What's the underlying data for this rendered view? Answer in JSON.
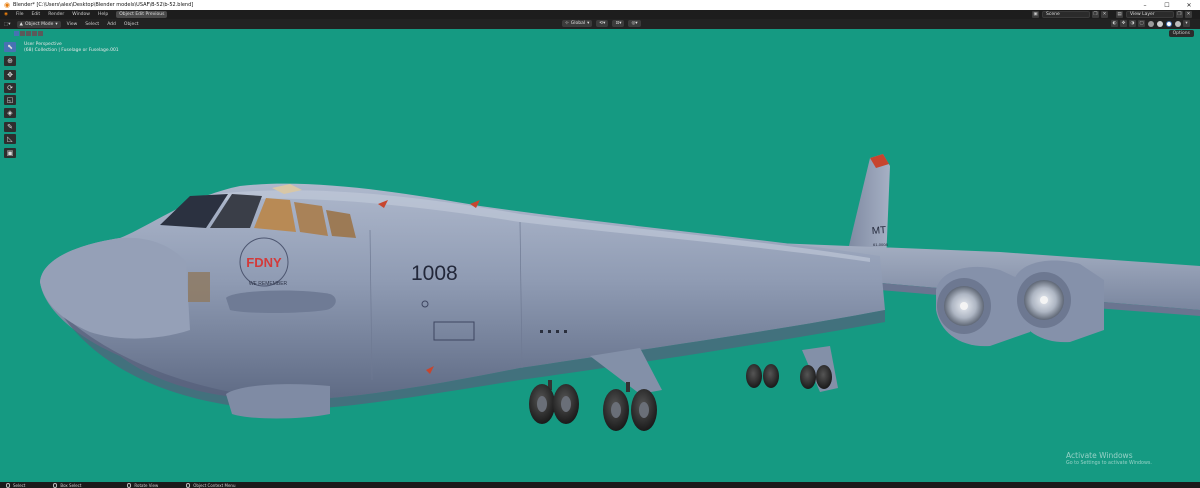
{
  "titlebar": {
    "title": "Blender* [C:\\Users\\alex\\Desktop\\Blender models\\USAF\\B-52\\b-52.blend]",
    "minimize": "–",
    "maximize": "☐",
    "close": "✕"
  },
  "menubar": {
    "items": [
      "File",
      "Edit",
      "Render",
      "Window",
      "Help"
    ],
    "workspace_tab": "Object Edit Previous",
    "scene_label": "Scene",
    "view_layer_label": "View Layer"
  },
  "viewport_header": {
    "mode": "Object Mode",
    "menus": [
      "View",
      "Select",
      "Add",
      "Object"
    ],
    "orientation": "Global"
  },
  "options_label": "Options",
  "viewport_info": {
    "line1": "User Perspective",
    "line2": "(68) Collection | Fuselage or Fuselage.001"
  },
  "aircraft": {
    "tail_number": "1008",
    "nose_text": "FDNY",
    "nose_subtext": "WE REMEMBER",
    "tail_code": "MT",
    "tail_serial": "61-0008"
  },
  "watermark": {
    "line1": "Activate Windows",
    "line2": "Go to Settings to activate Windows."
  },
  "statusbar": {
    "items": [
      "Select",
      "Box Select",
      "Rotate View",
      "Object Context Menu"
    ]
  },
  "colors": {
    "viewport_bg": "#159a82",
    "fuselage": "#8e9cb4",
    "accent": "#4772b3"
  }
}
